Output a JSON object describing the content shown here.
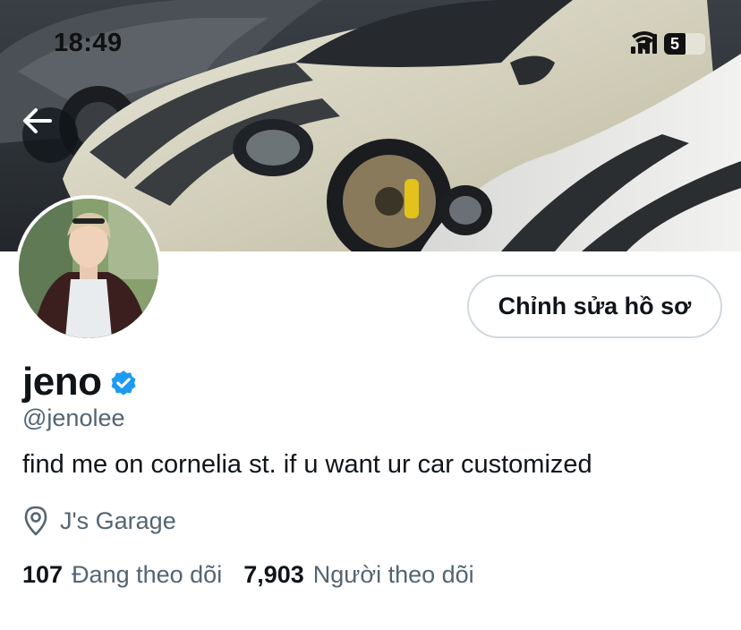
{
  "status_bar": {
    "time": "18:49",
    "battery_level": "5",
    "icons": [
      "signal-icon",
      "wifi-icon",
      "battery-icon"
    ]
  },
  "header": {
    "back_icon": "arrow-left-icon",
    "banner_subject": "cars"
  },
  "profile": {
    "display_name": "jeno",
    "verified_icon": "verified-badge-icon",
    "handle": "@jenolee",
    "bio": "find me on cornelia st. if u want ur car customized",
    "location_icon": "location-pin-icon",
    "location": "J's Garage",
    "edit_button_label": "Chỉnh sửa hồ sơ",
    "following_count": "107",
    "following_label": "Đang theo dõi",
    "followers_count": "7,903",
    "followers_label": "Người theo dõi"
  },
  "colors": {
    "text_primary": "#0f1419",
    "text_secondary": "#536471",
    "verified_blue": "#1d9bf0",
    "button_border": "#cfd9de"
  }
}
